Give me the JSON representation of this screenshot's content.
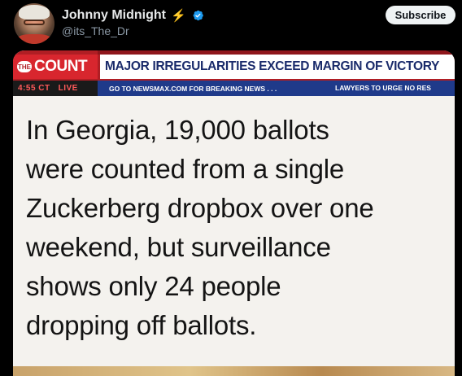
{
  "post": {
    "author": {
      "display_name": "Johnny Midnight",
      "handle": "@its_The_Dr",
      "badge_icon": "lightning-bolt-icon",
      "verified_icon": "verified-badge-icon",
      "verified_color": "#1d9bf0"
    },
    "subscribe_label": "Subscribe"
  },
  "image": {
    "logo_the": "THE",
    "logo_count": "COUNT",
    "headline": "MAJOR IRREGULARITIES EXCEED MARGIN OF VICTORY",
    "time": "4:55 CT",
    "live": "LIVE",
    "ticker_left": "GO TO NEWSMAX.COM FOR BREAKING NEWS . . .",
    "ticker_right": "LAWYERS TO URGE NO RES",
    "body_lines": [
      "In Georgia, 19,000 ballots",
      "were counted from a single",
      "Zuckerberg dropbox over one",
      "weekend, but surveillance",
      "shows only 24 people",
      "dropping off ballots."
    ],
    "colors": {
      "ticker_red": "#b01e24",
      "headline_blue": "#1a2b6b",
      "sub_ticker_blue": "#1f3a8a"
    }
  }
}
